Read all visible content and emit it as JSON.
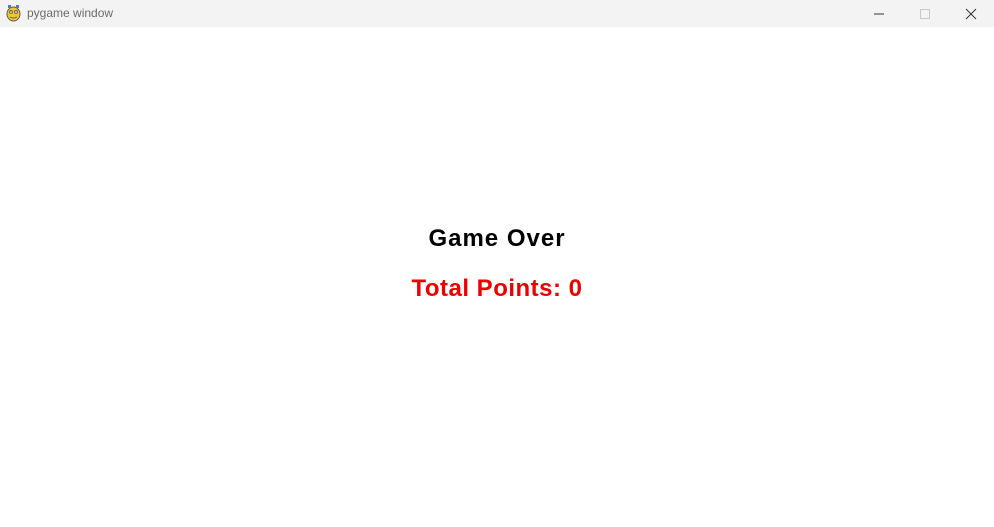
{
  "window": {
    "title": "pygame window",
    "icon": "pygame-snake-icon",
    "controls": [
      "minimize-icon",
      "maximize-icon",
      "close-icon"
    ]
  },
  "game": {
    "game_over_text": "Game Over",
    "points_text": "Total Points: 0",
    "points_color": "#ee0000",
    "game_over_color": "#000000",
    "background_color": "#ffffff"
  }
}
